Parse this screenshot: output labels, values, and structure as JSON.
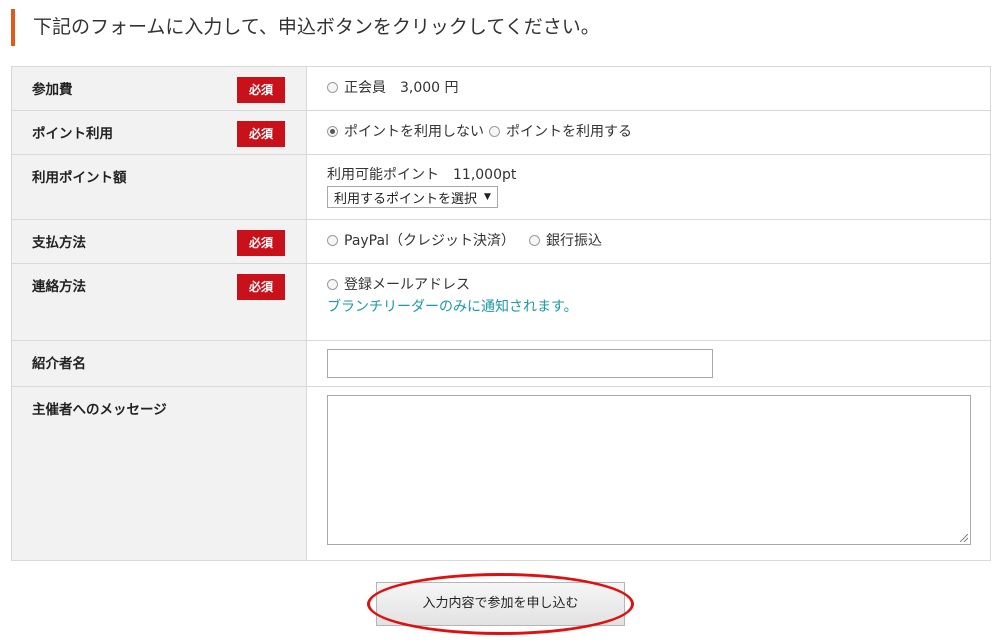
{
  "header": {
    "instruction": "下記のフォームに入力して、申込ボタンをクリックしてください。"
  },
  "colors": {
    "accent_bar": "#e05a1c",
    "required_badge": "#c8111a",
    "note_text": "#1a9aa8",
    "highlight_circle": "#e01010"
  },
  "required_label": "必須",
  "form": {
    "fee": {
      "label": "参加費",
      "options": [
        {
          "label": "正会員　3,000 円",
          "checked": false
        }
      ]
    },
    "point_use": {
      "label": "ポイント利用",
      "options": [
        {
          "label": "ポイントを利用しない",
          "checked": true
        },
        {
          "label": "ポイントを利用する",
          "checked": false
        }
      ]
    },
    "point_amount": {
      "label": "利用ポイント額",
      "available": "利用可能ポイント　11,000pt",
      "select_value": "利用するポイントを選択"
    },
    "payment": {
      "label": "支払方法",
      "options": [
        {
          "label": "PayPal（クレジット決済）",
          "checked": false
        },
        {
          "label": "銀行振込",
          "checked": false
        }
      ]
    },
    "contact": {
      "label": "連絡方法",
      "options": [
        {
          "label": "登録メールアドレス",
          "checked": false
        }
      ],
      "note": "ブランチリーダーのみに通知されます。"
    },
    "referrer": {
      "label": "紹介者名",
      "value": ""
    },
    "message": {
      "label": "主催者へのメッセージ",
      "value": ""
    }
  },
  "submit": {
    "label": "入力内容で参加を申し込む"
  }
}
